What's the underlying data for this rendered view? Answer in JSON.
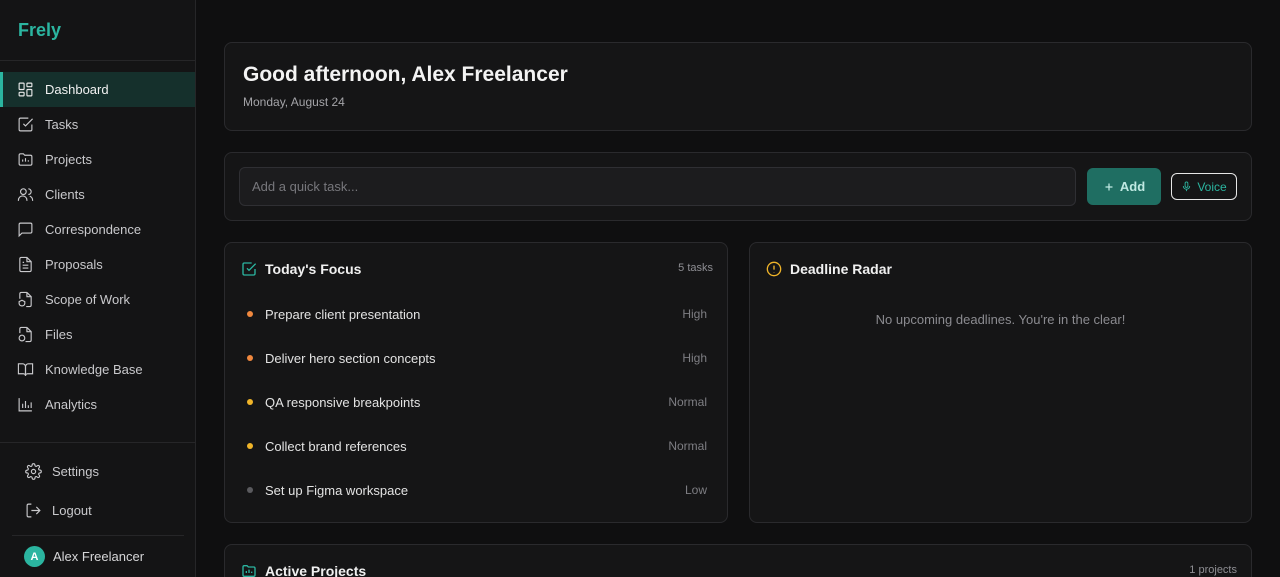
{
  "app": {
    "name": "Frely"
  },
  "sidebar": {
    "items": [
      {
        "label": "Dashboard",
        "icon": "dashboard-icon",
        "active": true
      },
      {
        "label": "Tasks",
        "icon": "checkbox-icon"
      },
      {
        "label": "Projects",
        "icon": "folder-icon"
      },
      {
        "label": "Clients",
        "icon": "users-icon"
      },
      {
        "label": "Correspondence",
        "icon": "message-icon"
      },
      {
        "label": "Proposals",
        "icon": "document-icon"
      },
      {
        "label": "Scope of Work",
        "icon": "file-shield-icon"
      },
      {
        "label": "Files",
        "icon": "file-icon"
      },
      {
        "label": "Knowledge Base",
        "icon": "book-icon"
      },
      {
        "label": "Analytics",
        "icon": "chart-icon"
      }
    ],
    "settings_label": "Settings",
    "logout_label": "Logout",
    "user": {
      "initial": "A",
      "name": "Alex Freelancer"
    }
  },
  "header": {
    "greeting": "Good afternoon, Alex Freelancer",
    "date": "Monday, August 24"
  },
  "quick_task": {
    "placeholder": "Add a quick task...",
    "add_label": "Add",
    "voice_label": "Voice"
  },
  "focus": {
    "title": "Today's Focus",
    "count": "5 tasks",
    "tasks": [
      {
        "label": "Prepare client presentation",
        "priority": "High"
      },
      {
        "label": "Deliver hero section concepts",
        "priority": "High"
      },
      {
        "label": "QA responsive breakpoints",
        "priority": "Normal"
      },
      {
        "label": "Collect brand references",
        "priority": "Normal"
      },
      {
        "label": "Set up Figma workspace",
        "priority": "Low"
      }
    ]
  },
  "radar": {
    "title": "Deadline Radar",
    "empty_text": "No upcoming deadlines. You're in the clear!"
  },
  "projects": {
    "title": "Active Projects",
    "count": "1 projects"
  },
  "colors": {
    "accent": "#2bb5a0",
    "high": "#f0883e",
    "normal": "#f0b429",
    "low": "#5a5a5e",
    "warning": "#f0b429"
  }
}
